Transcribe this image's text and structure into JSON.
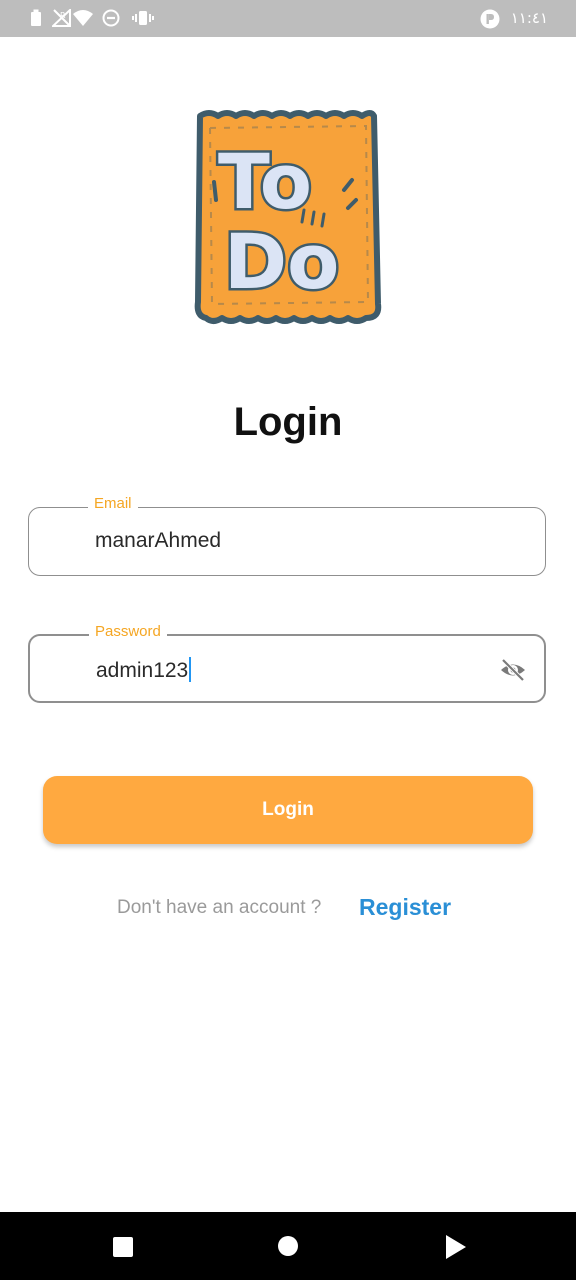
{
  "status_bar": {
    "time": "١١:٤١",
    "icons": [
      "battery-icon",
      "no-signal-icon",
      "wifi-icon",
      "do-not-disturb-icon",
      "vibrate-icon",
      "app-notification-icon"
    ]
  },
  "logo": {
    "line1": "To",
    "line2": "Do"
  },
  "page": {
    "title": "Login"
  },
  "email_field": {
    "label": "Email",
    "value": "manarAhmed"
  },
  "password_field": {
    "label": "Password",
    "value": "admin123",
    "visibility_icon": "eye-off-icon"
  },
  "login_button": {
    "label": "Login"
  },
  "register": {
    "prompt": "Don't have an account ?",
    "link": "Register"
  },
  "nav_bar": {
    "icons": [
      "recent-apps-icon",
      "home-icon",
      "back-icon"
    ]
  },
  "colors": {
    "accent": "#ffa940",
    "label": "#f5a623",
    "link": "#2a8fd6",
    "status_bar": "#bdbdbd",
    "logo_fill": "#f7a23a",
    "logo_outline": "#3f5c6b"
  }
}
